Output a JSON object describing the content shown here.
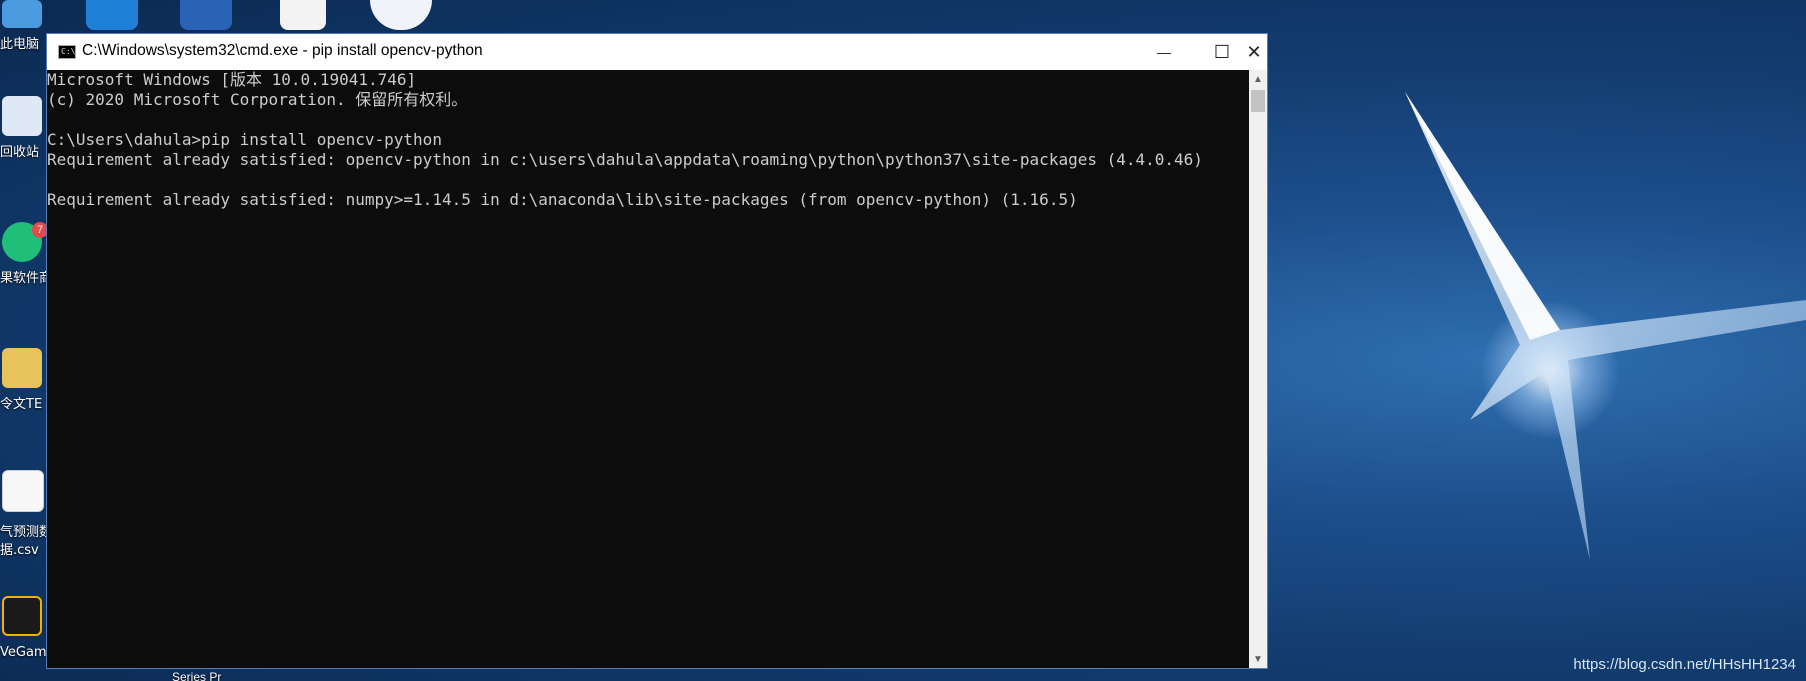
{
  "window": {
    "title": "C:\\Windows\\system32\\cmd.exe - pip  install opencv-python",
    "minimize_glyph": "—",
    "maximize_glyph": "☐",
    "close_glyph": "✕"
  },
  "console": {
    "lines": [
      "Microsoft Windows [版本 10.0.19041.746]",
      "(c) 2020 Microsoft Corporation. 保留所有权利。",
      "",
      "C:\\Users\\dahula>pip install opencv-python",
      "Requirement already satisfied: opencv-python in c:\\users\\dahula\\appdata\\roaming\\python\\python37\\site-packages (4.4.0.46)",
      "",
      "Requirement already satisfied: numpy>=1.14.5 in d:\\anaconda\\lib\\site-packages (from opencv-python) (1.16.5)"
    ]
  },
  "desktop": {
    "icons": [
      {
        "label": "此电脑",
        "icon": "computer-icon"
      },
      {
        "label": "回收站",
        "icon": "recycle-bin-icon"
      },
      {
        "label": "果软件商",
        "icon": "store-bag-icon",
        "badge": "7"
      },
      {
        "label": "令文TE",
        "icon": "folder-icon"
      },
      {
        "label": "气预测数",
        "label2": "据.csv",
        "icon": "csv-file-icon"
      },
      {
        "label": "VeGam",
        "icon": "wegame-icon"
      }
    ],
    "partial_label": "Series Pr",
    "watermark": "https://blog.csdn.net/HHsHH1234"
  },
  "colors": {
    "console_bg": "#0c0c0c",
    "console_text": "#cccccc",
    "titlebar_bg": "#ffffff"
  }
}
